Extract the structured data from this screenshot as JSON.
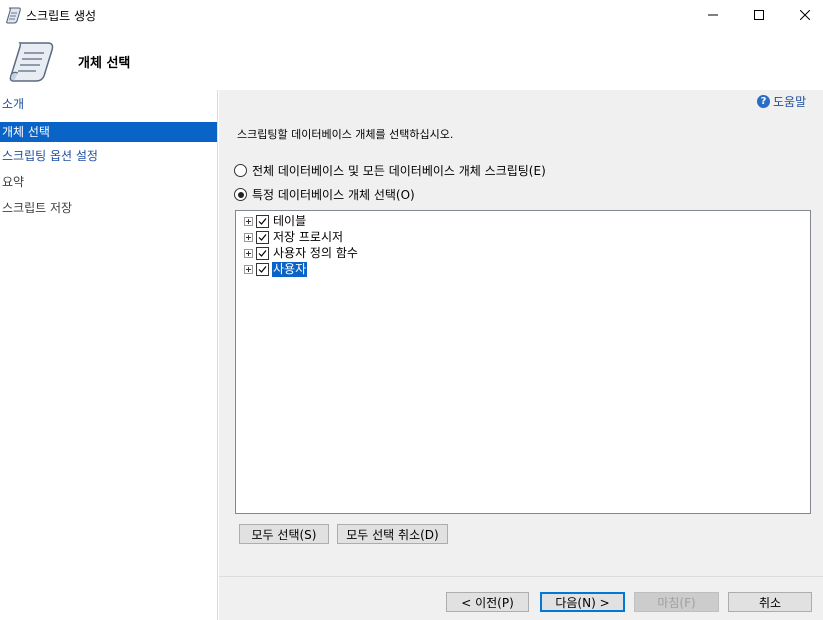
{
  "window": {
    "title": "스크립트 생성",
    "controls": {
      "minimize": "—",
      "maximize": "☐",
      "close": "✕"
    }
  },
  "header": {
    "heading": "개체 선택"
  },
  "sidebar": {
    "items": [
      {
        "label": "소개",
        "state": "link"
      },
      {
        "label": "개체 선택",
        "state": "selected"
      },
      {
        "label": "스크립팅 옵션 설정",
        "state": "link"
      },
      {
        "label": "요약",
        "state": "disabled"
      },
      {
        "label": "스크립트 저장",
        "state": "disabled"
      }
    ]
  },
  "content": {
    "help_label": "도움말",
    "instruction": "스크립팅할 데이터베이스 개체를 선택하십시오.",
    "radio_all": {
      "label": "전체 데이터베이스 및 모든 데이터베이스 개체 스크립팅(E)",
      "checked": false
    },
    "radio_specific": {
      "label": "특정 데이터베이스 개체 선택(O)",
      "checked": true
    },
    "tree": [
      {
        "label": "테이블",
        "checked": true,
        "selected": false
      },
      {
        "label": "저장 프로시저",
        "checked": true,
        "selected": false
      },
      {
        "label": "사용자 정의 함수",
        "checked": true,
        "selected": false
      },
      {
        "label": "사용자",
        "checked": true,
        "selected": true
      }
    ],
    "select_all": "모두 선택(S)",
    "deselect_all": "모두 선택 취소(D)"
  },
  "footer": {
    "prev": "< 이전(P)",
    "next": "다음(N) >",
    "finish": "마침(F)",
    "cancel": "취소"
  },
  "colors": {
    "accent": "#0a64c8",
    "link": "#1f4fa0",
    "panel": "#f0f0f0"
  }
}
